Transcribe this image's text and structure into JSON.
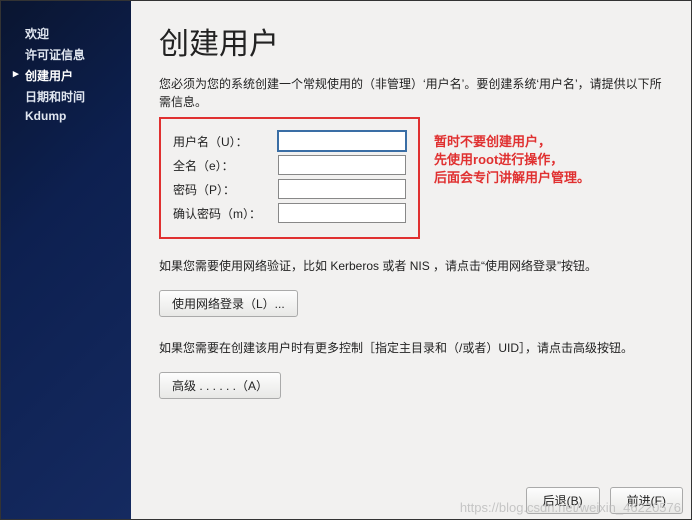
{
  "sidebar": {
    "items": [
      {
        "label": "欢迎"
      },
      {
        "label": "许可证信息"
      },
      {
        "label": "创建用户"
      },
      {
        "label": "日期和时间"
      },
      {
        "label": "Kdump"
      }
    ]
  },
  "main": {
    "title": "创建用户",
    "intro": "您必须为您的系统创建一个常规使用的（非管理）‘用户名’。要创建系统‘用户名’，请提供以下所需信息。",
    "form": {
      "username_label": "用户名（U）：",
      "fullname_label": "全名（e）：",
      "password_label": "密码（P）：",
      "confirm_label": "确认密码（m）：",
      "username_value": "",
      "fullname_value": "",
      "password_value": "",
      "confirm_value": ""
    },
    "annotation": {
      "line1": "暂时不要创建用户，",
      "line2_pre": "先使用",
      "line2_root": "root",
      "line2_post": "进行操作，",
      "line3": "后面会专门讲解用户管理。"
    },
    "network_note": "如果您需要使用网络验证，比如 Kerberos 或者 NIS ，请点击“使用网络登录”按钮。",
    "network_button": "使用网络登录（L）...",
    "advanced_note": "如果您需要在创建该用户时有更多控制［指定主目录和（/或者）UID］，请点击高级按钮。",
    "advanced_button": "高级 . . . . . .（A）",
    "back_button": "后退(B)",
    "forward_button": "前进(F)"
  },
  "watermark": "https://blog.csdn.net/weixin_46220576"
}
